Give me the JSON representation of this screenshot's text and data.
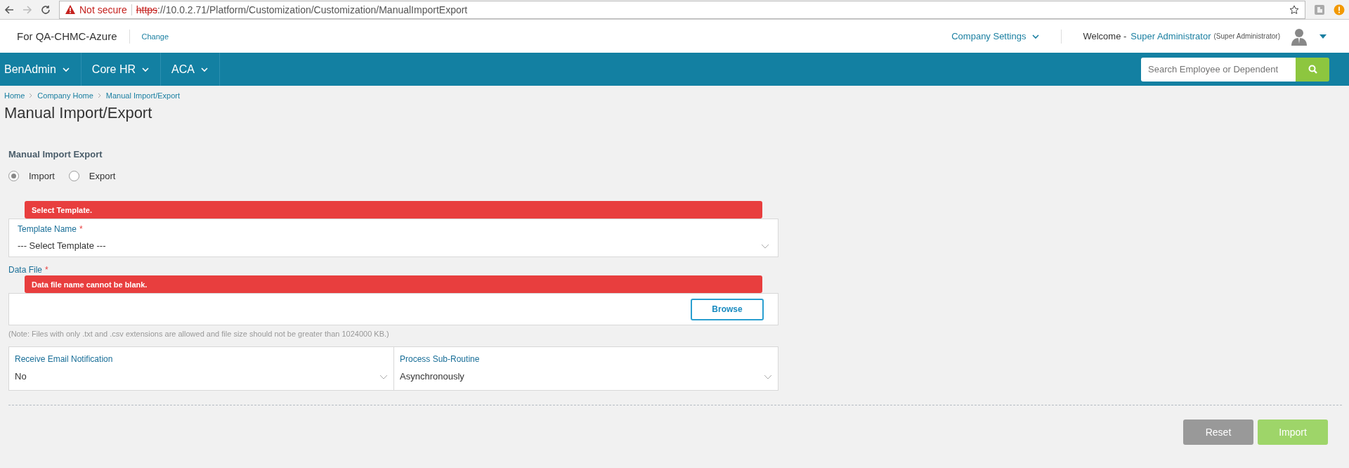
{
  "browser": {
    "security": "Not secure",
    "url_scheme": "https",
    "url_rest": "://10.0.2.71/Platform/Customization/Customization/ManualImportExport"
  },
  "header": {
    "company": "For QA-CHMC-Azure",
    "change": "Change",
    "settings": "Company Settings",
    "welcome": "Welcome -",
    "user": "Super Administrator",
    "role": "(Super Administrator)"
  },
  "nav": {
    "items": [
      {
        "label": "BenAdmin"
      },
      {
        "label": "Core HR"
      },
      {
        "label": "ACA"
      }
    ],
    "search_placeholder": "Search Employee or Dependent"
  },
  "breadcrumb": [
    "Home",
    "Company Home",
    "Manual Import/Export"
  ],
  "title": "Manual Import/Export",
  "section_title": "Manual Import Export",
  "radios": [
    {
      "label": "Import",
      "selected": true
    },
    {
      "label": "Export",
      "selected": false
    }
  ],
  "template": {
    "label": "Template Name",
    "required_mark": "*",
    "value": "--- Select Template ---",
    "error": "Select Template."
  },
  "data_file": {
    "label": "Data File",
    "required_mark": "*",
    "error": "Data file name cannot be blank.",
    "browse": "Browse"
  },
  "note": "(Note: Files with only .txt and .csv extensions are allowed and file size should not be greater than 1024000 KB.)",
  "selects": [
    {
      "label": "Receive Email Notification",
      "value": "No"
    },
    {
      "label": "Process Sub-Routine",
      "value": "Asynchronously"
    }
  ],
  "buttons": [
    {
      "label": "Reset",
      "kind": "secondary"
    },
    {
      "label": "Import",
      "kind": "primary"
    }
  ]
}
